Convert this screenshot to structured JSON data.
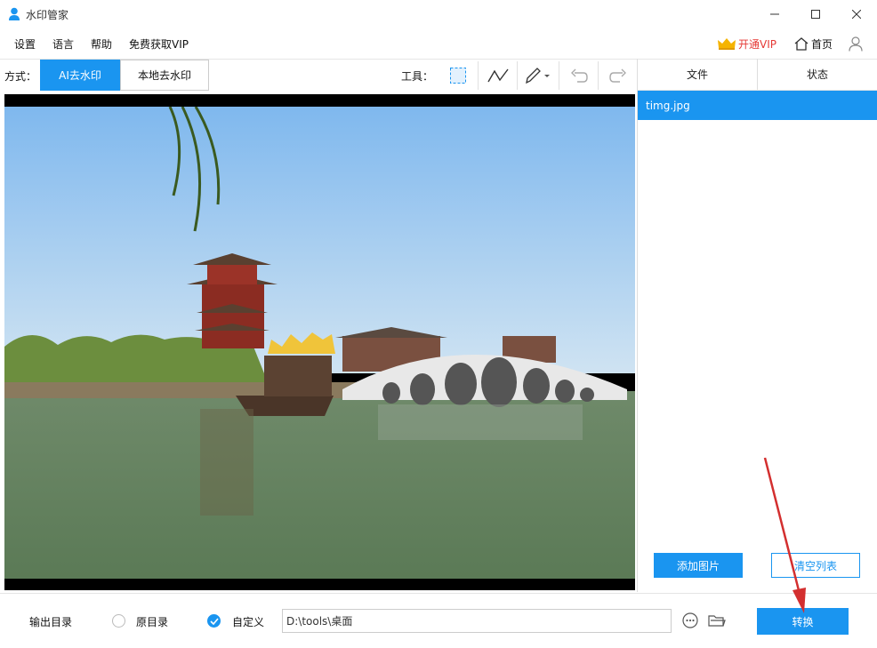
{
  "window": {
    "title": "水印管家"
  },
  "menu": {
    "items": [
      "设置",
      "语言",
      "帮助",
      "免费获取VIP"
    ],
    "vip_label": "开通VIP",
    "home_label": "首页"
  },
  "mode": {
    "label": "方式：",
    "options": [
      "AI去水印",
      "本地去水印"
    ],
    "selected": "AI去水印"
  },
  "tools": {
    "label": "工具：",
    "items": [
      "rect-select-icon",
      "line-icon",
      "brush-icon",
      "undo-icon",
      "redo-icon"
    ]
  },
  "file_panel": {
    "columns": [
      "文件",
      "状态"
    ],
    "files": [
      {
        "name": "timg.jpg",
        "status": ""
      }
    ],
    "add_button": "添加图片",
    "clear_button": "清空列表"
  },
  "output": {
    "label": "输出目录",
    "options": [
      "原目录",
      "自定义"
    ],
    "selected": "自定义",
    "path": "D:\\tools\\桌面",
    "convert_button": "转换"
  },
  "colors": {
    "accent": "#1a95f0",
    "vip": "#e53935",
    "annotation_arrow": "#d32f2f"
  }
}
